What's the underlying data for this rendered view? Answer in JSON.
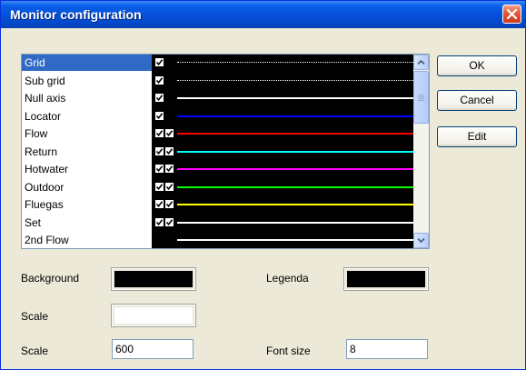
{
  "window": {
    "title": "Monitor configuration"
  },
  "colors": {
    "list_background": "#000000",
    "selection": "#316ac5",
    "titlebar": "#0450d6"
  },
  "icons": {
    "close": "close-icon",
    "checkbox": "checkmark-icon",
    "scroll_up": "chevron-up-icon",
    "scroll_down": "chevron-down-icon"
  },
  "list": {
    "rows": [
      {
        "label": "Grid",
        "check1": true,
        "check2": false,
        "line_color": "#ffffff",
        "line_style": "dotted",
        "selected": true
      },
      {
        "label": "Sub grid",
        "check1": true,
        "check2": false,
        "line_color": "#ffffff",
        "line_style": "dotted"
      },
      {
        "label": "Null axis",
        "check1": true,
        "check2": false,
        "line_color": "#ffffff",
        "line_style": "solid"
      },
      {
        "label": "Locator",
        "check1": true,
        "check2": false,
        "line_color": "#0000ff",
        "line_style": "solid"
      },
      {
        "label": "Flow",
        "check1": true,
        "check2": true,
        "line_color": "#ff0000",
        "line_style": "solid"
      },
      {
        "label": "Return",
        "check1": true,
        "check2": true,
        "line_color": "#00ffff",
        "line_style": "solid"
      },
      {
        "label": "Hotwater",
        "check1": true,
        "check2": true,
        "line_color": "#ff00ff",
        "line_style": "solid"
      },
      {
        "label": "Outdoor",
        "check1": true,
        "check2": true,
        "line_color": "#00ff00",
        "line_style": "solid"
      },
      {
        "label": "Fluegas",
        "check1": true,
        "check2": true,
        "line_color": "#ffff00",
        "line_style": "solid"
      },
      {
        "label": "Set",
        "check1": true,
        "check2": true,
        "line_color": "#ffffff",
        "line_style": "solid"
      },
      {
        "label": "2nd Flow",
        "check1": false,
        "check2": false,
        "line_color": "#ffffff",
        "line_style": "solid"
      }
    ]
  },
  "buttons": {
    "ok": "OK",
    "cancel": "Cancel",
    "edit": "Edit"
  },
  "form": {
    "background_label": "Background",
    "background_color": "#000000",
    "legenda_label": "Legenda",
    "legenda_color": "#000000",
    "scale_color_label": "Scale",
    "scale_color": "#ffffff",
    "scale_label": "Scale",
    "scale_value": "600",
    "font_size_label": "Font size",
    "font_size_value": "8"
  }
}
